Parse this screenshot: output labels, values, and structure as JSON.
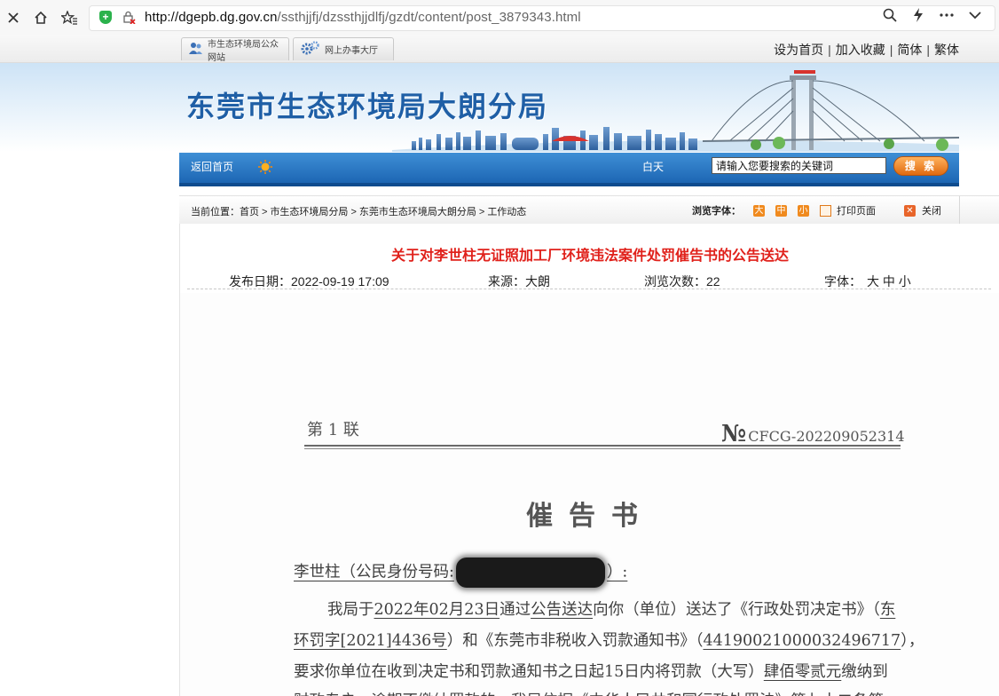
{
  "browser": {
    "url_host": "http://dgepb.dg.gov.cn",
    "url_path": "/ssthjjfj/dzssthjjdlfj/gzdt/content/post_3879343.html"
  },
  "topbar": {
    "tab_portal": "市生态环境局公众网站",
    "tab_service": "网上办事大厅",
    "links": [
      "设为首页",
      "加入收藏",
      "简体",
      "繁体"
    ],
    "sep": "|"
  },
  "banner": {
    "title": "东莞市生态环境局大朗分局"
  },
  "nav": {
    "home": "返回首页",
    "day_mode": "白天",
    "search_value": "请输入您要搜索的关键词",
    "search_button": "搜 索"
  },
  "breadcrumb": {
    "label": "当前位置：",
    "items": [
      "首页",
      "市生态环境局分局",
      "东莞市生态环境局大朗分局",
      "工作动态"
    ],
    "sep": ">",
    "font_label": "浏览字体：",
    "font_large": "大",
    "font_medium": "中",
    "font_small": "小",
    "print": "打印页面",
    "close": "关闭"
  },
  "article": {
    "title": "关于对李世柱无证照加工厂环境违法案件处罚催告书的公告送达",
    "publish_date": "发布日期：2022-09-19  17:09",
    "source": "来源：大朗",
    "views": "浏览次数：22",
    "font_label": "字体：",
    "font_sizes": "大 中 小"
  },
  "document": {
    "copy_label": "第 1 联",
    "serial_no": "№",
    "serial": "CFCG-202209052314",
    "heading": "催告书",
    "recipient_prefix": "李世柱（公民身份号码:",
    "recipient_suffix": "）:",
    "line1_a": "我局于",
    "line1_date": "2022年02月23日",
    "line1_b": "通过",
    "line1_method": "公告送达",
    "line1_c": "向你（单位）送达了《行政处罚决定书》（",
    "line1_d": "东",
    "line2_a": "环罚字[2021]4436号",
    "line2_b": "）和《东莞市非税收入罚款通知书》（",
    "line2_code": "441900210000324967​17",
    "line2_c": "），",
    "line3_a": "要求你单位在收到决定书和罚款通知书之日起15日内将罚款（大写）",
    "line3_amount": "肆佰零贰元",
    "line3_b": "缴纳到",
    "line4": "财政专户，逾期不缴纳罚款的，我局依据《中华人民共和国行政处罚法》第七十二条第"
  }
}
